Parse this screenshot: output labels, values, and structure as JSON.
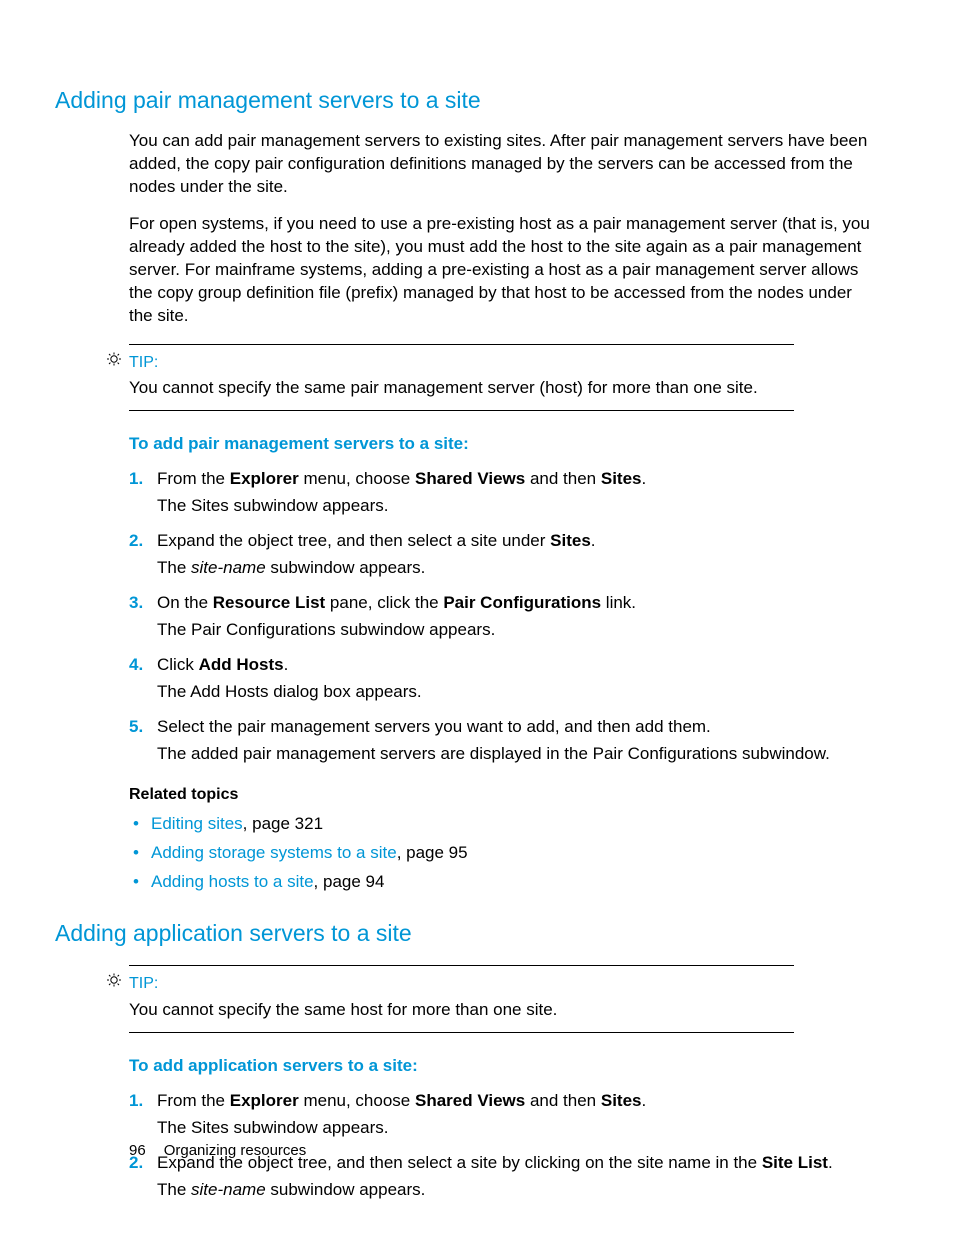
{
  "section1": {
    "title": "Adding pair management servers to a site",
    "para1": "You can add pair management servers to existing sites. After pair management servers have been added, the copy pair configuration definitions managed by the servers can be accessed from the nodes under the site.",
    "para2": "For open systems, if you need to use a pre-existing host as a pair management server (that is, you already added the host to the site), you must add the host to the site again as a pair management server. For mainframe systems, adding a pre-existing a host as a pair management server allows the copy group definition file (prefix) managed by that host to be accessed from the nodes under the site.",
    "tip_label": "TIP:",
    "tip_body": "You cannot specify the same pair management server (host) for more than one site.",
    "procedure_title": "To add pair management servers to a site:",
    "steps": [
      {
        "num": "1.",
        "main_pre": "From the ",
        "main_b1": "Explorer",
        "main_mid1": " menu, choose ",
        "main_b2": "Shared Views",
        "main_mid2": " and then ",
        "main_b3": "Sites",
        "main_post": ".",
        "sub": "The Sites subwindow appears."
      },
      {
        "num": "2.",
        "main_pre": "Expand the object tree, and then select a site under ",
        "main_b1": "Sites",
        "main_post": ".",
        "sub_pre": "The ",
        "sub_it": "site-name",
        "sub_post": " subwindow appears."
      },
      {
        "num": "3.",
        "main_pre": "On the ",
        "main_b1": "Resource List",
        "main_mid1": " pane, click the ",
        "main_b2": "Pair Configurations",
        "main_post": " link.",
        "sub": "The Pair Configurations subwindow appears."
      },
      {
        "num": "4.",
        "main_pre": "Click ",
        "main_b1": "Add Hosts",
        "main_post": ".",
        "sub": "The Add Hosts dialog box appears."
      },
      {
        "num": "5.",
        "main": "Select the pair management servers you want to add, and then add them.",
        "sub": "The added pair management servers are displayed in the Pair Configurations subwindow."
      }
    ],
    "related_title": "Related topics",
    "related": [
      {
        "link": "Editing sites",
        "post": ", page 321"
      },
      {
        "link": "Adding storage systems to a site",
        "post": ", page 95"
      },
      {
        "link": "Adding hosts to a site",
        "post": ", page 94"
      }
    ]
  },
  "section2": {
    "title": "Adding application servers to a site",
    "tip_label": "TIP:",
    "tip_body": "You cannot specify the same host for more than one site.",
    "procedure_title": "To add application servers to a site:",
    "steps": [
      {
        "num": "1.",
        "main_pre": "From the ",
        "main_b1": "Explorer",
        "main_mid1": " menu, choose ",
        "main_b2": "Shared Views",
        "main_mid2": " and then ",
        "main_b3": "Sites",
        "main_post": ".",
        "sub": "The Sites subwindow appears."
      },
      {
        "num": "2.",
        "main_pre": "Expand the object tree, and then select a site by clicking on the site name in the ",
        "main_b1": "Site List",
        "main_post": ".",
        "sub_pre": "The ",
        "sub_it": "site-name",
        "sub_post": " subwindow appears."
      }
    ]
  },
  "footer": {
    "page_num": "96",
    "chapter": "Organizing resources"
  }
}
